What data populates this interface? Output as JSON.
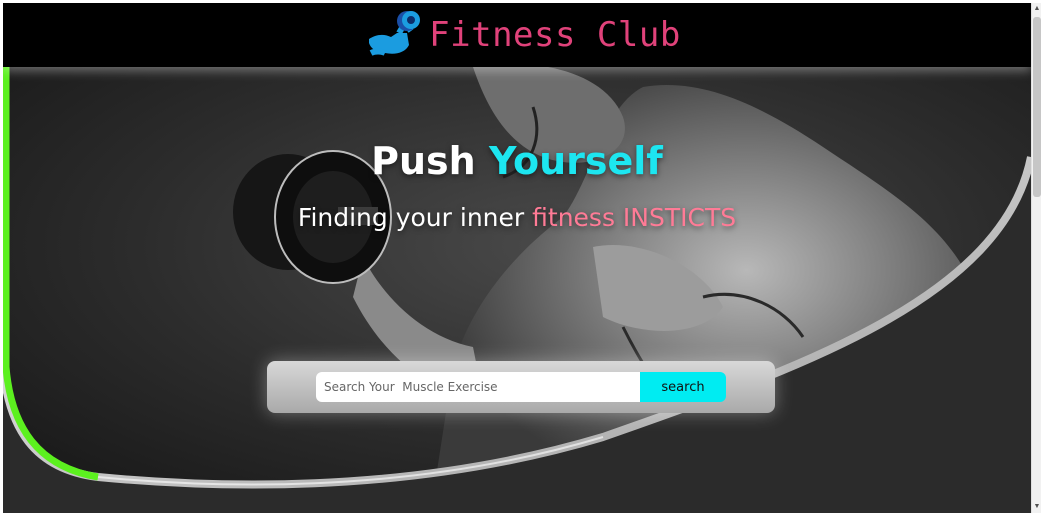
{
  "header": {
    "logo_icon": "flexed-arm-dumbbell-icon",
    "title": "Fitness Club",
    "brand_color": "#e0427a"
  },
  "hero": {
    "headline_part1": "Push",
    "headline_part2": "Yourself",
    "subhead_part1": "Finding your inner",
    "subhead_part2": "fitness INSTICTS",
    "background_image": "bodybuilder-dumbbell-curl-photo",
    "accent_color": "#1de6f0",
    "edge_color": "#5cf01f"
  },
  "search": {
    "placeholder": "Search Your  Muscle Exercise",
    "button_label": "search",
    "button_color": "#00ecf2"
  },
  "scrollbar": {
    "up_icon": "scroll-up-arrow-icon",
    "down_icon": "scroll-down-arrow-icon"
  }
}
